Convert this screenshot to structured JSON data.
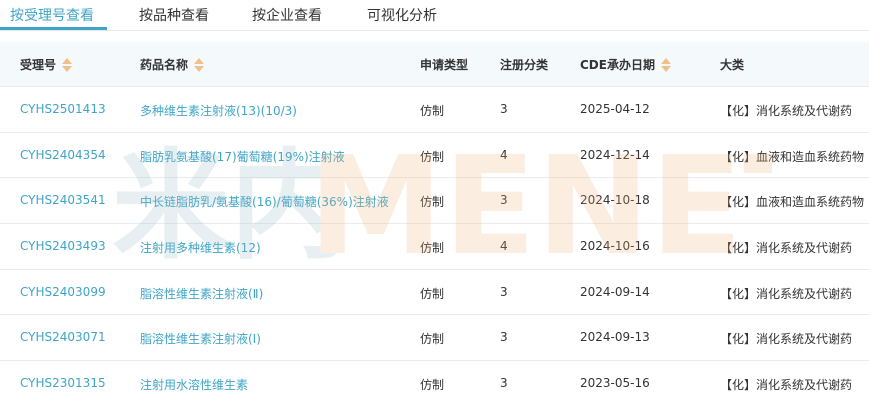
{
  "tabs": [
    {
      "label": "按受理号查看",
      "active": true
    },
    {
      "label": "按品种查看",
      "active": false
    },
    {
      "label": "按企业查看",
      "active": false
    },
    {
      "label": "可视化分析",
      "active": false
    }
  ],
  "table": {
    "headers": {
      "accept_no": "受理号",
      "drug_name": "药品名称",
      "apply_type": "申请类型",
      "reg_class": "注册分类",
      "cde_date": "CDE承办日期",
      "category": "大类"
    },
    "rows": [
      {
        "accept_no": "CYHS2501413",
        "drug_name": "多种维生素注射液(13)(10/3)",
        "apply_type": "仿制",
        "reg_class": "3",
        "cde_date": "2025-04-12",
        "category": "【化】消化系统及代谢药"
      },
      {
        "accept_no": "CYHS2404354",
        "drug_name": "脂肪乳氨基酸(17)葡萄糖(19%)注射液",
        "apply_type": "仿制",
        "reg_class": "4",
        "cde_date": "2024-12-14",
        "category": "【化】血液和造血系统药物"
      },
      {
        "accept_no": "CYHS2403541",
        "drug_name": "中长链脂肪乳/氨基酸(16)/葡萄糖(36%)注射液",
        "apply_type": "仿制",
        "reg_class": "3",
        "cde_date": "2024-10-18",
        "category": "【化】血液和造血系统药物"
      },
      {
        "accept_no": "CYHS2403493",
        "drug_name": "注射用多种维生素(12)",
        "apply_type": "仿制",
        "reg_class": "4",
        "cde_date": "2024-10-16",
        "category": "【化】消化系统及代谢药"
      },
      {
        "accept_no": "CYHS2403099",
        "drug_name": "脂溶性维生素注射液(Ⅱ)",
        "apply_type": "仿制",
        "reg_class": "3",
        "cde_date": "2024-09-14",
        "category": "【化】消化系统及代谢药"
      },
      {
        "accept_no": "CYHS2403071",
        "drug_name": "脂溶性维生素注射液(Ⅰ)",
        "apply_type": "仿制",
        "reg_class": "3",
        "cde_date": "2024-09-13",
        "category": "【化】消化系统及代谢药"
      },
      {
        "accept_no": "CYHS2301315",
        "drug_name": "注射用水溶性维生素",
        "apply_type": "仿制",
        "reg_class": "3",
        "cde_date": "2023-05-16",
        "category": "【化】消化系统及代谢药"
      }
    ]
  },
  "watermark": {
    "text": "MENET",
    "prefix": "米内",
    "colors": {
      "prefix": "#9ab8c8",
      "text": "#f2b27a"
    }
  },
  "colors": {
    "accent": "#3fa5c6",
    "sort_arrow": "#f0c08a",
    "header_bg": "#f4f9fc"
  }
}
